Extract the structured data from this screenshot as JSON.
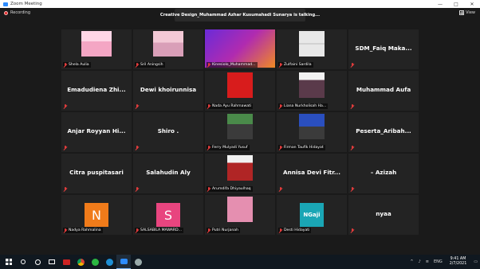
{
  "window": {
    "title": "Zoom Meeting",
    "min": "—",
    "max": "□",
    "close": "✕"
  },
  "recording": {
    "label": "Recording"
  },
  "talking": {
    "text": "Creative Design_Muhammad Azhar Kusumahadi Sunarya is talking..."
  },
  "view": {
    "label": "View"
  },
  "tiles": [
    {
      "name": "Shela Aulia",
      "kind": "photo",
      "photo": "hijab-pink"
    },
    {
      "name": "Sril Aningsih",
      "kind": "photo",
      "photo": "hijab-pink2"
    },
    {
      "name": "Kinesiolo_Muhammad...",
      "kind": "photo",
      "photo": "screen"
    },
    {
      "name": "Zulfaini Sardila",
      "kind": "photo",
      "photo": "screens"
    },
    {
      "name": "SDM_Faiq  Maka...",
      "kind": "text"
    },
    {
      "name": "Emadudiena  Zhi...",
      "kind": "text"
    },
    {
      "name": "Dewi khoirunnisa",
      "kind": "text"
    },
    {
      "name": "Nada Ayu Rahmawati",
      "kind": "photo",
      "photo": "red-hijab"
    },
    {
      "name": "Liana Nurkholisah Ha...",
      "kind": "photo",
      "photo": "hijab-dark"
    },
    {
      "name": "Muhammad Aufa",
      "kind": "text"
    },
    {
      "name": "Anjar Royyan Hi...",
      "kind": "text"
    },
    {
      "name": "Shiro .",
      "kind": "text"
    },
    {
      "name": "Ferry Mulyadi Yusuf",
      "kind": "photo",
      "photo": "man-green"
    },
    {
      "name": "Firman Taufik Hidayat",
      "kind": "photo",
      "photo": "man-blue"
    },
    {
      "name": "Peserta_Aribah...",
      "kind": "text"
    },
    {
      "name": "Citra puspitasari",
      "kind": "text"
    },
    {
      "name": "Salahudin Aly",
      "kind": "text"
    },
    {
      "name": "Arumdifa Dhiyaulhaq",
      "kind": "photo",
      "photo": "hijab-red2"
    },
    {
      "name": "Annisa  Devi  Fitr...",
      "kind": "text"
    },
    {
      "name": "– Azizah",
      "kind": "text"
    },
    {
      "name": "Nadya Rahmalina",
      "kind": "avatar",
      "letter": "N",
      "color": "#f07b1a"
    },
    {
      "name": "SALSABILA MAWARD...",
      "kind": "avatar",
      "letter": "S",
      "color": "#e8457f"
    },
    {
      "name": "Putri Nurjanah",
      "kind": "photo",
      "photo": "pink-pic"
    },
    {
      "name": "Desti Hidayati",
      "kind": "avatar",
      "letter": "NGaji",
      "color": "#1aa6b5"
    },
    {
      "name": "nyaa",
      "kind": "text"
    }
  ],
  "taskbar": {
    "search": "search-icon",
    "lang": "ENG",
    "time": "9:41 AM",
    "date": "2/7/2021"
  }
}
